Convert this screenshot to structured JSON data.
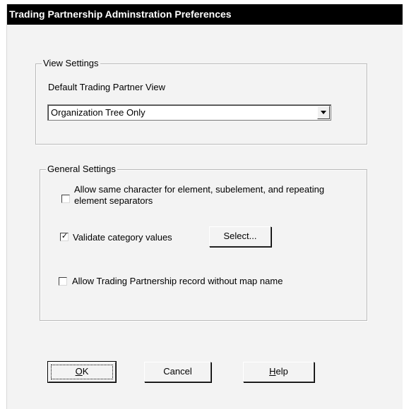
{
  "window": {
    "title": "Trading Partnership Adminstration Preferences"
  },
  "view_settings": {
    "group_label": "View Settings",
    "default_view_label": "Default Trading Partner View",
    "default_view_value": "Organization Tree Only"
  },
  "general_settings": {
    "group_label": "General Settings",
    "allow_same_char": {
      "label_line1": "Allow same character for element, subelement, and repeating",
      "label_line2": "element separators",
      "checked": false
    },
    "validate_category": {
      "label": "Validate category values",
      "checked": true,
      "check_glyph": "✓"
    },
    "select_button": "Select...",
    "allow_without_map": {
      "label": "Allow Trading Partnership record without map name",
      "checked": false
    }
  },
  "buttons": {
    "ok": {
      "mnemonic": "O",
      "rest": "K"
    },
    "cancel": "Cancel",
    "help": {
      "mnemonic": "H",
      "rest": "elp"
    }
  }
}
